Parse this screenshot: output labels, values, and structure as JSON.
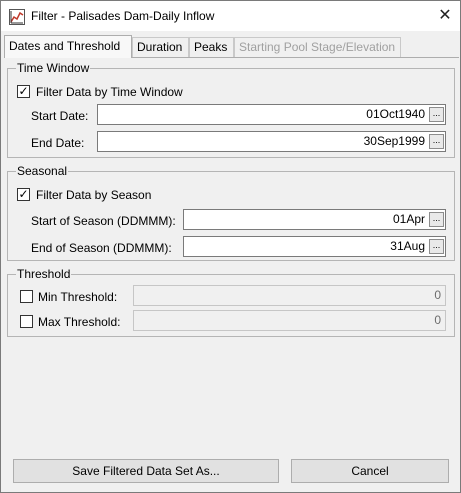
{
  "window": {
    "title": "Filter - Palisades Dam-Daily Inflow",
    "close_symbol": "✕"
  },
  "tabs": [
    {
      "label": "Dates and Threshold",
      "state": "active"
    },
    {
      "label": "Duration",
      "state": "normal"
    },
    {
      "label": "Peaks",
      "state": "normal"
    },
    {
      "label": "Starting Pool Stage/Elevation",
      "state": "disabled"
    }
  ],
  "time_window": {
    "group_title": "Time Window",
    "filter_checkbox_label": "Filter Data by Time Window",
    "filter_checked": true,
    "start_date_label": "Start Date:",
    "start_date_value": "01Oct1940",
    "end_date_label": "End Date:",
    "end_date_value": "30Sep1999",
    "browse_label": "..."
  },
  "seasonal": {
    "group_title": "Seasonal",
    "filter_checkbox_label": "Filter Data by Season",
    "filter_checked": true,
    "start_label": "Start of Season (DDMMM):",
    "start_value": "01Apr",
    "end_label": "End of Season (DDMMM):",
    "end_value": "31Aug",
    "browse_label": "..."
  },
  "threshold": {
    "group_title": "Threshold",
    "min_label": "Min Threshold:",
    "min_checked": false,
    "min_value": "0",
    "max_label": "Max Threshold:",
    "max_checked": false,
    "max_value": "0"
  },
  "footer": {
    "save_label": "Save Filtered Data Set As...",
    "cancel_label": "Cancel"
  },
  "check_glyph": "✓",
  "icons": {
    "app": "chart-app-icon",
    "close": "close-icon",
    "browse": "ellipsis-icon"
  }
}
